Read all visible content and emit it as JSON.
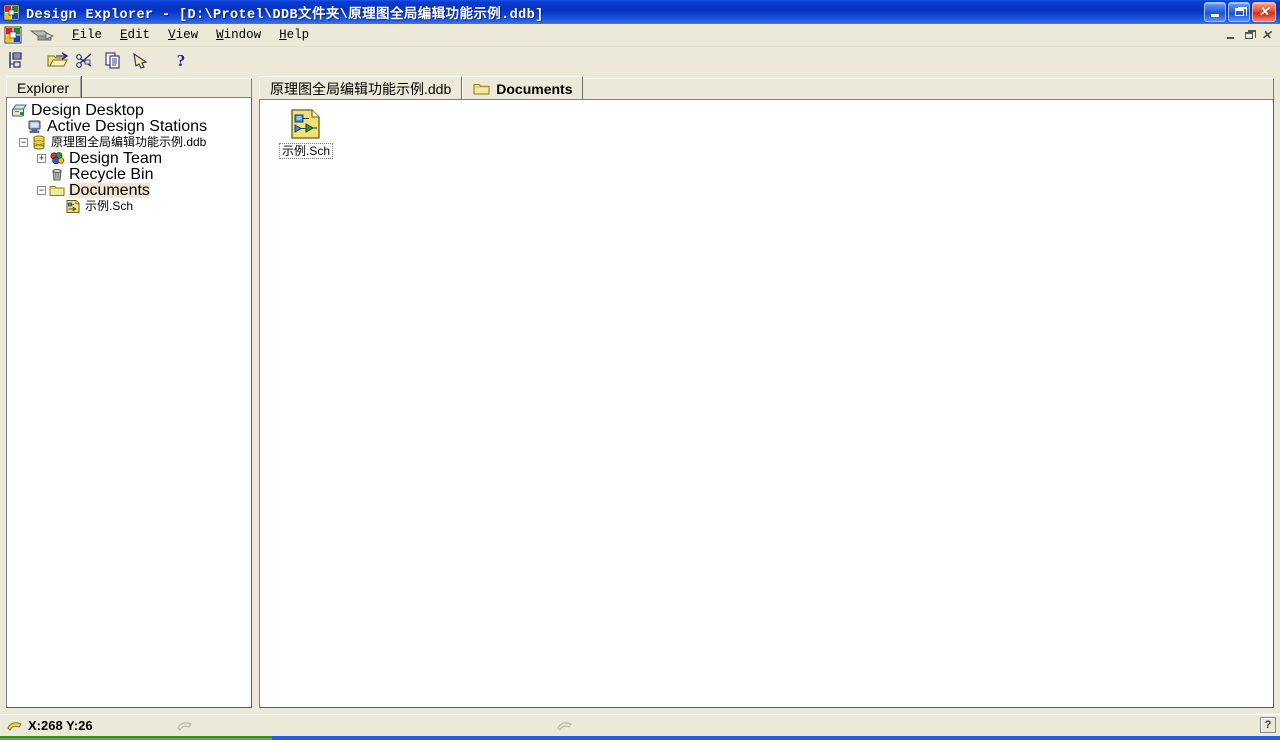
{
  "window": {
    "title": "Design Explorer - [D:\\Protel\\DDB文件夹\\原理图全局编辑功能示例.ddb]",
    "app_icon": "design-explorer-icon",
    "buttons": {
      "minimize": "minimize",
      "restore": "restore",
      "close": "close"
    }
  },
  "menubar": {
    "app_icon": "document-appicon",
    "doc_icon": "grey-arrow-icon",
    "items": [
      {
        "label": "File",
        "mnemonic": "F"
      },
      {
        "label": "Edit",
        "mnemonic": "E"
      },
      {
        "label": "View",
        "mnemonic": "V"
      },
      {
        "label": "Window",
        "mnemonic": "W"
      },
      {
        "label": "Help",
        "mnemonic": "H"
      }
    ],
    "mdi_buttons": {
      "minimize": "minimize",
      "restore": "restore",
      "close": "close"
    }
  },
  "toolbar": {
    "buttons": [
      {
        "name": "explorer-tree-icon",
        "tooltip": "Toggle Explorer Panel"
      },
      {
        "name": "open-folder-icon",
        "tooltip": "Open"
      },
      {
        "name": "cut-icon",
        "tooltip": "Cut"
      },
      {
        "name": "copy-icon",
        "tooltip": "Copy"
      },
      {
        "name": "paste-icon",
        "tooltip": "Paste"
      },
      {
        "name": "help-icon",
        "tooltip": "Help"
      }
    ]
  },
  "left_panel": {
    "tab_label": "Explorer",
    "tree": [
      {
        "label": "Design Desktop",
        "icon": "design-desktop-icon",
        "indent": 0,
        "expander": "none",
        "selected": false
      },
      {
        "label": "Active Design Stations",
        "icon": "workstation-icon",
        "indent": 1,
        "expander": "none",
        "selected": false
      },
      {
        "label": "原理图全局编辑功能示例.ddb",
        "icon": "database-icon",
        "indent": 1,
        "expander": "collapse",
        "selected": false
      },
      {
        "label": "Design Team",
        "icon": "design-team-icon",
        "indent": 2,
        "expander": "expand",
        "selected": false
      },
      {
        "label": "Recycle Bin",
        "icon": "recycle-bin-icon",
        "indent": 2,
        "expander": "none",
        "selected": false
      },
      {
        "label": "Documents",
        "icon": "folder-icon",
        "indent": 2,
        "expander": "collapse",
        "selected": true
      },
      {
        "label": "示例.Sch",
        "icon": "schematic-icon",
        "indent": 3,
        "expander": "none",
        "selected": false
      }
    ]
  },
  "right_panel": {
    "tabs": [
      {
        "label": "原理图全局编辑功能示例.ddb",
        "icon": null,
        "active": false
      },
      {
        "label": "Documents",
        "icon": "folder-icon",
        "active": true
      }
    ],
    "files": [
      {
        "label": "示例.Sch",
        "icon": "schematic-icon",
        "selected": true
      }
    ]
  },
  "statusbar": {
    "coordinates": "X:268 Y:26",
    "cursor_icon": "pen-cursor-icon",
    "panel2_icon": "pen-cursor-icon-grey",
    "panel3_icon": "pen-cursor-icon-grey",
    "help_button": "?"
  },
  "colors": {
    "titlebar_blue": "#0a3cd0",
    "titlebar_blue_light": "#2a66ea",
    "close_red": "#cf2d18",
    "chrome": "#ece9d8",
    "panel_white": "#ffffff",
    "folder_yellow": "#f7e68a",
    "taskbar_blue": "#245edb",
    "taskbar_green": "#3b8c1e"
  }
}
